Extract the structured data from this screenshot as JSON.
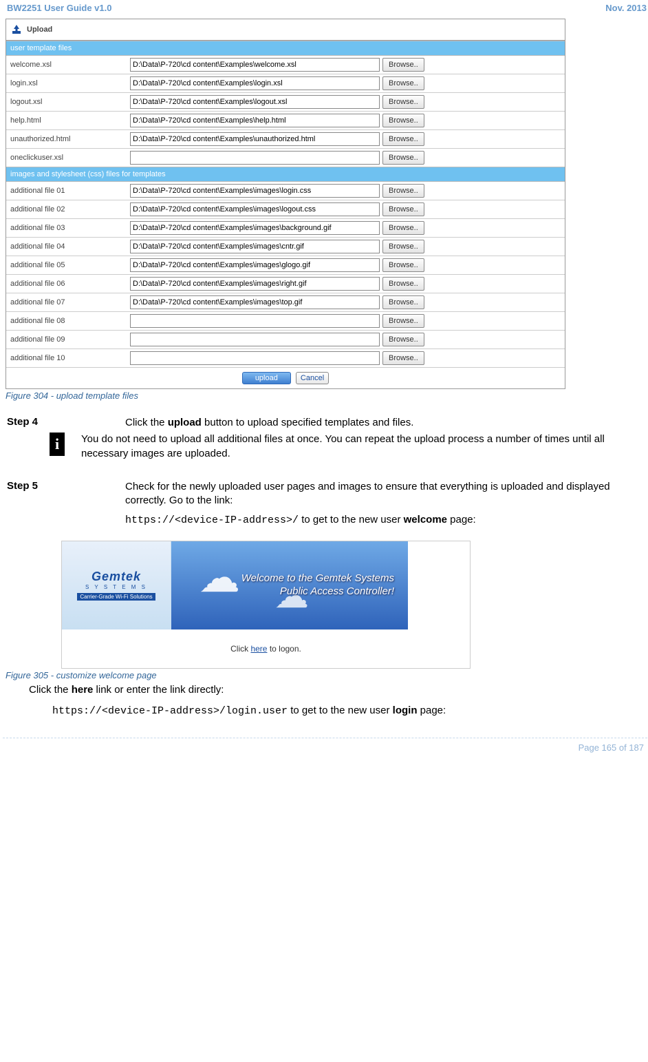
{
  "header": {
    "left": "BW2251 User Guide v1.0",
    "right": "Nov.  2013"
  },
  "panel": {
    "title": "Upload",
    "section_user": "user template files",
    "section_images": "images and stylesheet (css) files for templates",
    "browse_label": "Browse..",
    "user_rows": [
      {
        "label": "welcome.xsl",
        "value": "D:\\Data\\P-720\\cd content\\Examples\\welcome.xsl"
      },
      {
        "label": "login.xsl",
        "value": "D:\\Data\\P-720\\cd content\\Examples\\login.xsl"
      },
      {
        "label": "logout.xsl",
        "value": "D:\\Data\\P-720\\cd content\\Examples\\logout.xsl"
      },
      {
        "label": "help.html",
        "value": "D:\\Data\\P-720\\cd content\\Examples\\help.html"
      },
      {
        "label": "unauthorized.html",
        "value": "D:\\Data\\P-720\\cd content\\Examples\\unauthorized.html"
      },
      {
        "label": "oneclickuser.xsl",
        "value": ""
      }
    ],
    "image_rows": [
      {
        "label": "additional file 01",
        "value": "D:\\Data\\P-720\\cd content\\Examples\\images\\login.css"
      },
      {
        "label": "additional file 02",
        "value": "D:\\Data\\P-720\\cd content\\Examples\\images\\logout.css"
      },
      {
        "label": "additional file 03",
        "value": "D:\\Data\\P-720\\cd content\\Examples\\images\\background.gif"
      },
      {
        "label": "additional file 04",
        "value": "D:\\Data\\P-720\\cd content\\Examples\\images\\cntr.gif"
      },
      {
        "label": "additional file 05",
        "value": "D:\\Data\\P-720\\cd content\\Examples\\images\\glogo.gif"
      },
      {
        "label": "additional file 06",
        "value": "D:\\Data\\P-720\\cd content\\Examples\\images\\right.gif"
      },
      {
        "label": "additional file 07",
        "value": "D:\\Data\\P-720\\cd content\\Examples\\images\\top.gif"
      },
      {
        "label": "additional file 08",
        "value": ""
      },
      {
        "label": "additional file 09",
        "value": ""
      },
      {
        "label": "additional file 10",
        "value": ""
      }
    ],
    "upload_button": "upload",
    "cancel_button": "Cancel"
  },
  "captions": {
    "upload": "Figure 304 - upload template files",
    "welcome": "Figure 305 - customize welcome page"
  },
  "steps": {
    "step4_label": "Step 4",
    "step4_pre": "Click the ",
    "step4_bold": "upload",
    "step4_post": " button to upload specified templates and files.",
    "note": "You do not need to upload all additional files at once. You can repeat the upload process a number of times until all necessary images are uploaded.",
    "step5_label": "Step 5",
    "step5_line1": "Check for the newly uploaded user pages and images to ensure that everything is uploaded and displayed correctly. Go to the link:",
    "step5_code": "https://<device-IP-address>/",
    "step5_post_code_pre": " to get to the new user ",
    "step5_post_code_bold": "welcome",
    "step5_post_code_post": " page:"
  },
  "welcome": {
    "brand": "Gemtek",
    "brand_sub": "S Y S T E M S",
    "brand_tag": "Carrier-Grade Wi-Fi Solutions",
    "banner_line1": "Welcome to the Gemtek Systems",
    "banner_line2": "Public Access Controller!",
    "logon_pre": "Click ",
    "logon_link": "here",
    "logon_post": " to logon."
  },
  "after_welcome": {
    "line_pre": "Click the ",
    "line_bold": "here",
    "line_post": " link or enter the link directly:",
    "code": "https://<device-IP-address>/login.user",
    "code_post_pre": " to get to the new user ",
    "code_post_bold": "login",
    "code_post_post": " page:"
  },
  "footer": "Page 165 of 187"
}
